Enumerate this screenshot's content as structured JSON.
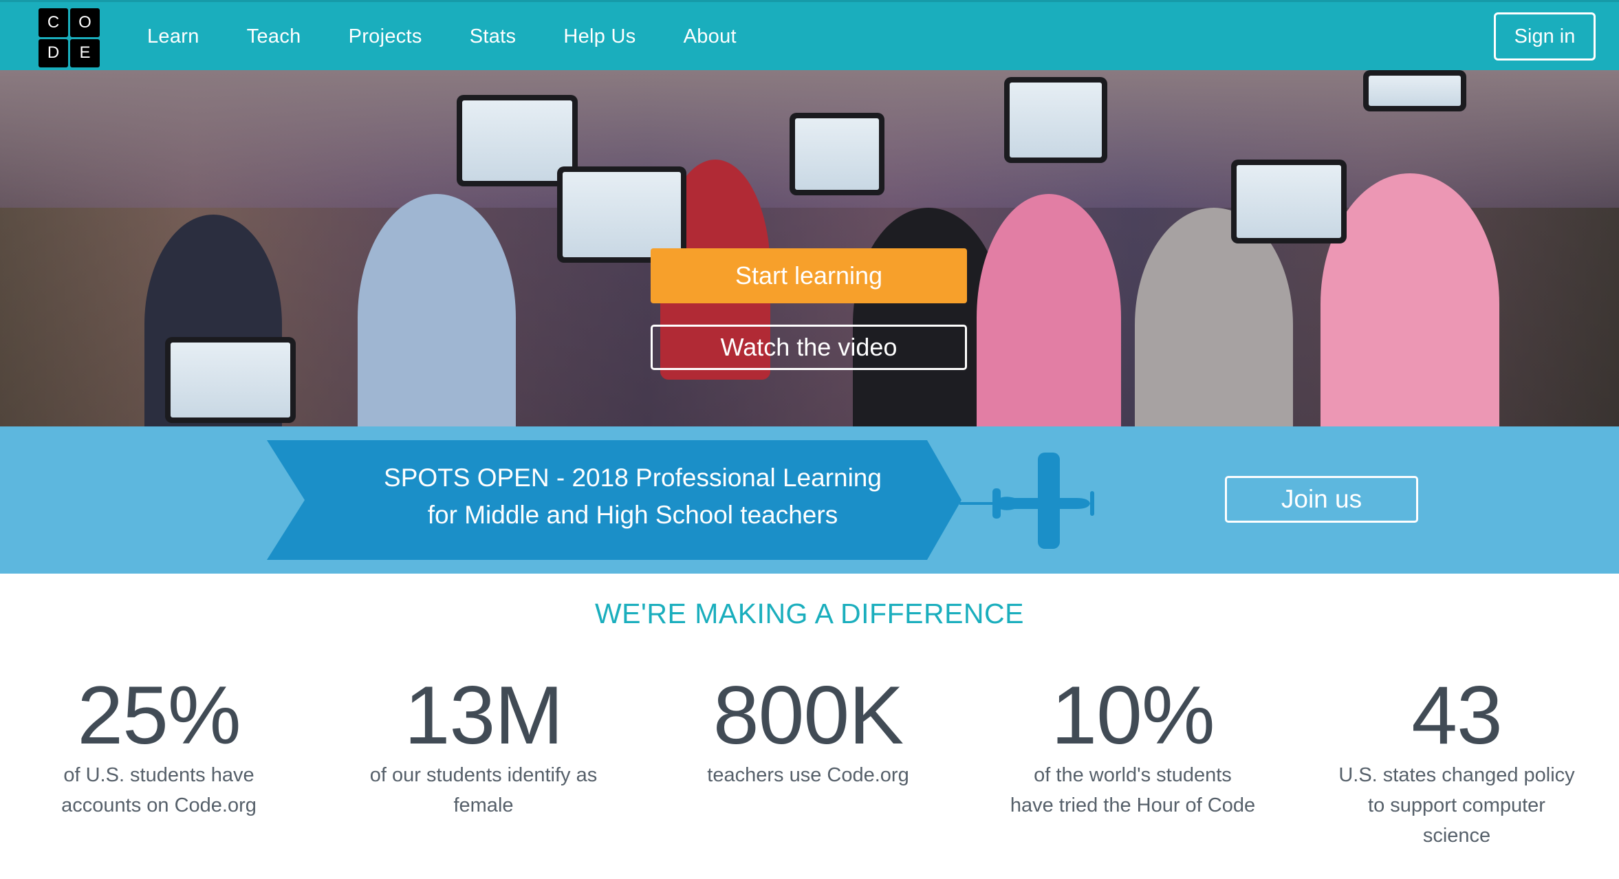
{
  "header": {
    "logo_letters": [
      "C",
      "O",
      "D",
      "E"
    ],
    "nav": [
      "Learn",
      "Teach",
      "Projects",
      "Stats",
      "Help Us",
      "About"
    ],
    "signin_label": "Sign in",
    "color": "#1aaebd"
  },
  "hero": {
    "start_label": "Start learning",
    "video_label": "Watch the video",
    "accent": "#f7a02b"
  },
  "banner": {
    "line1": "SPOTS OPEN - 2018 Professional Learning",
    "line2": "for Middle and High School teachers",
    "join_label": "Join us",
    "icon": "airplane-icon",
    "color": "#5db7de"
  },
  "stats": {
    "title": "WE'RE MAKING A DIFFERENCE",
    "items": [
      {
        "num": "25%",
        "desc1": "of U.S. students have",
        "desc2": "accounts on Code.org",
        "desc3": ""
      },
      {
        "num": "13M",
        "desc1": "of our students identify as",
        "desc2": "female",
        "desc3": ""
      },
      {
        "num": "800K",
        "desc1": "teachers use Code.org",
        "desc2": "",
        "desc3": ""
      },
      {
        "num": "10%",
        "desc1": "of the world's students",
        "desc2": "have tried the Hour of Code",
        "desc3": ""
      },
      {
        "num": "43",
        "desc1": "U.S. states changed policy",
        "desc2": "to support computer",
        "desc3": "science"
      }
    ]
  }
}
